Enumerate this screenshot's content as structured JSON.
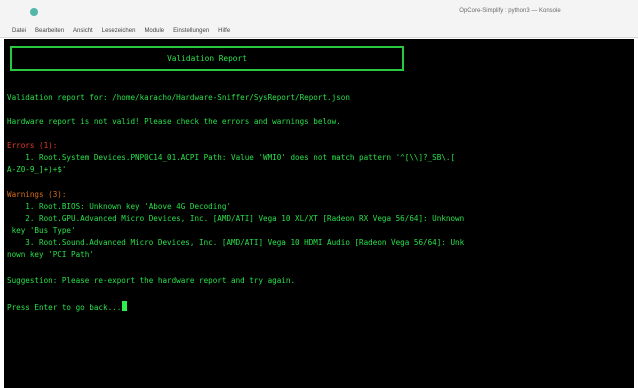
{
  "window": {
    "title": "OpCore-Simplify : python3 — Konsole"
  },
  "menu": {
    "items": [
      "Datei",
      "Bearbeiten",
      "Ansicht",
      "Lesezeichen",
      "Module",
      "Einstellungen",
      "Hilfe"
    ]
  },
  "terminal": {
    "banner": "Validation Report",
    "report_for": "Validation report for: /home/karacho/Hardware-Sniffer/SysReport/Report.json",
    "invalid_msg": "Hardware report is not valid! Please check the errors and warnings below.",
    "errors_header": "Errors (1):",
    "errors": [
      {
        "line1": "    1. Root.System Devices.PNP0C14_01.ACPI Path: Value 'WMI0' does not match pattern '^[\\\\]?_SB\\.[",
        "line2": "A-Z0-9_]+)+$'"
      }
    ],
    "warnings_header": "Warnings (3):",
    "warnings": [
      {
        "line1": "    1. Root.BIOS: Unknown key 'Above 4G Decoding'"
      },
      {
        "line1": "    2. Root.GPU.Advanced Micro Devices, Inc. [AMD/ATI] Vega 10 XL/XT [Radeon RX Vega 56/64]: Unknown",
        "line2": " key 'Bus Type'"
      },
      {
        "line1": "    3. Root.Sound.Advanced Micro Devices, Inc. [AMD/ATI] Vega 10 HDMI Audio [Radeon Vega 56/64]: Unk",
        "line2": "nown key 'PCI Path'"
      }
    ],
    "suggestion": "Suggestion: Please re-export the hardware report and try again.",
    "prompt": "Press Enter to go back..."
  },
  "colors": {
    "text_green": "#28e04a",
    "error_red": "#e83a2a",
    "warning_orange": "#d9701c",
    "background": "#000000"
  }
}
